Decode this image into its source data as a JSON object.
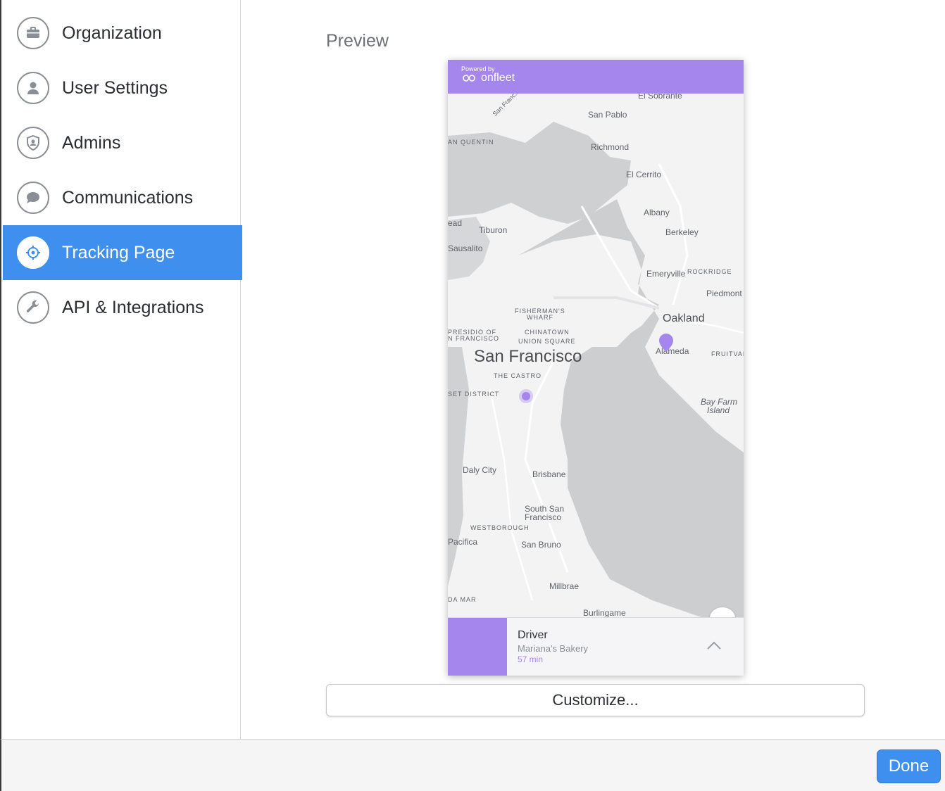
{
  "sidebar": {
    "items": [
      {
        "label": "Organization",
        "icon": "briefcase-icon",
        "active": false
      },
      {
        "label": "User Settings",
        "icon": "user-icon",
        "active": false
      },
      {
        "label": "Admins",
        "icon": "shield-user-icon",
        "active": false
      },
      {
        "label": "Communications",
        "icon": "chat-bubble-icon",
        "active": false
      },
      {
        "label": "Tracking Page",
        "icon": "crosshair-icon",
        "active": true
      },
      {
        "label": "API & Integrations",
        "icon": "wrench-icon",
        "active": false
      }
    ]
  },
  "main": {
    "title": "Preview",
    "preview": {
      "powered_by": "Powered by",
      "brand": "onfleet",
      "map_labels": {
        "el_sobrante": "El Sobrante",
        "san_francisco_diag": "San Franc...",
        "san_pablo": "San Pablo",
        "san_quentin": "AN QUENTIN",
        "richmond": "Richmond",
        "el_cerrito": "El Cerrito",
        "albany": "Albany",
        "berkeley": "Berkeley",
        "ead": "ead",
        "tiburon": "Tiburon",
        "sausalito": "Sausalito",
        "emeryville": "Emeryville",
        "rockridge": "ROCKRIDGE",
        "piedmont": "Piedmont",
        "fishermans_wharf_1": "FISHERMAN'S",
        "fishermans_wharf_2": "WHARF",
        "oakland": "Oakland",
        "presidio_1": "PRESIDIO OF",
        "presidio_2": "N FRANCISCO",
        "chinatown": "CHINATOWN",
        "union_square": "UNION SQUARE",
        "alameda": "Alameda",
        "fruitvale": "FRUITVAL",
        "san_francisco": "San Francisco",
        "the_castro": "THE CASTRO",
        "sunset_district": "SET DISTRICT",
        "bay_farm_1": "Bay Farm",
        "bay_farm_2": "Island",
        "daly_city": "Daly City",
        "brisbane": "Brisbane",
        "south_sf_1": "South San",
        "south_sf_2": "Francisco",
        "westborough": "WESTBOROUGH",
        "pacifica": "Pacifica",
        "san_bruno": "San Bruno",
        "millbrae": "Millbrae",
        "da_mar": "DA MAR",
        "burlingame": "Burlingame"
      },
      "driver": {
        "title": "Driver",
        "organization": "Mariana's Bakery",
        "eta": "57 min"
      }
    },
    "customize_label": "Customize..."
  },
  "footer": {
    "done_label": "Done"
  },
  "colors": {
    "accent": "#3f8fef",
    "brand_purple": "#a586ec"
  }
}
